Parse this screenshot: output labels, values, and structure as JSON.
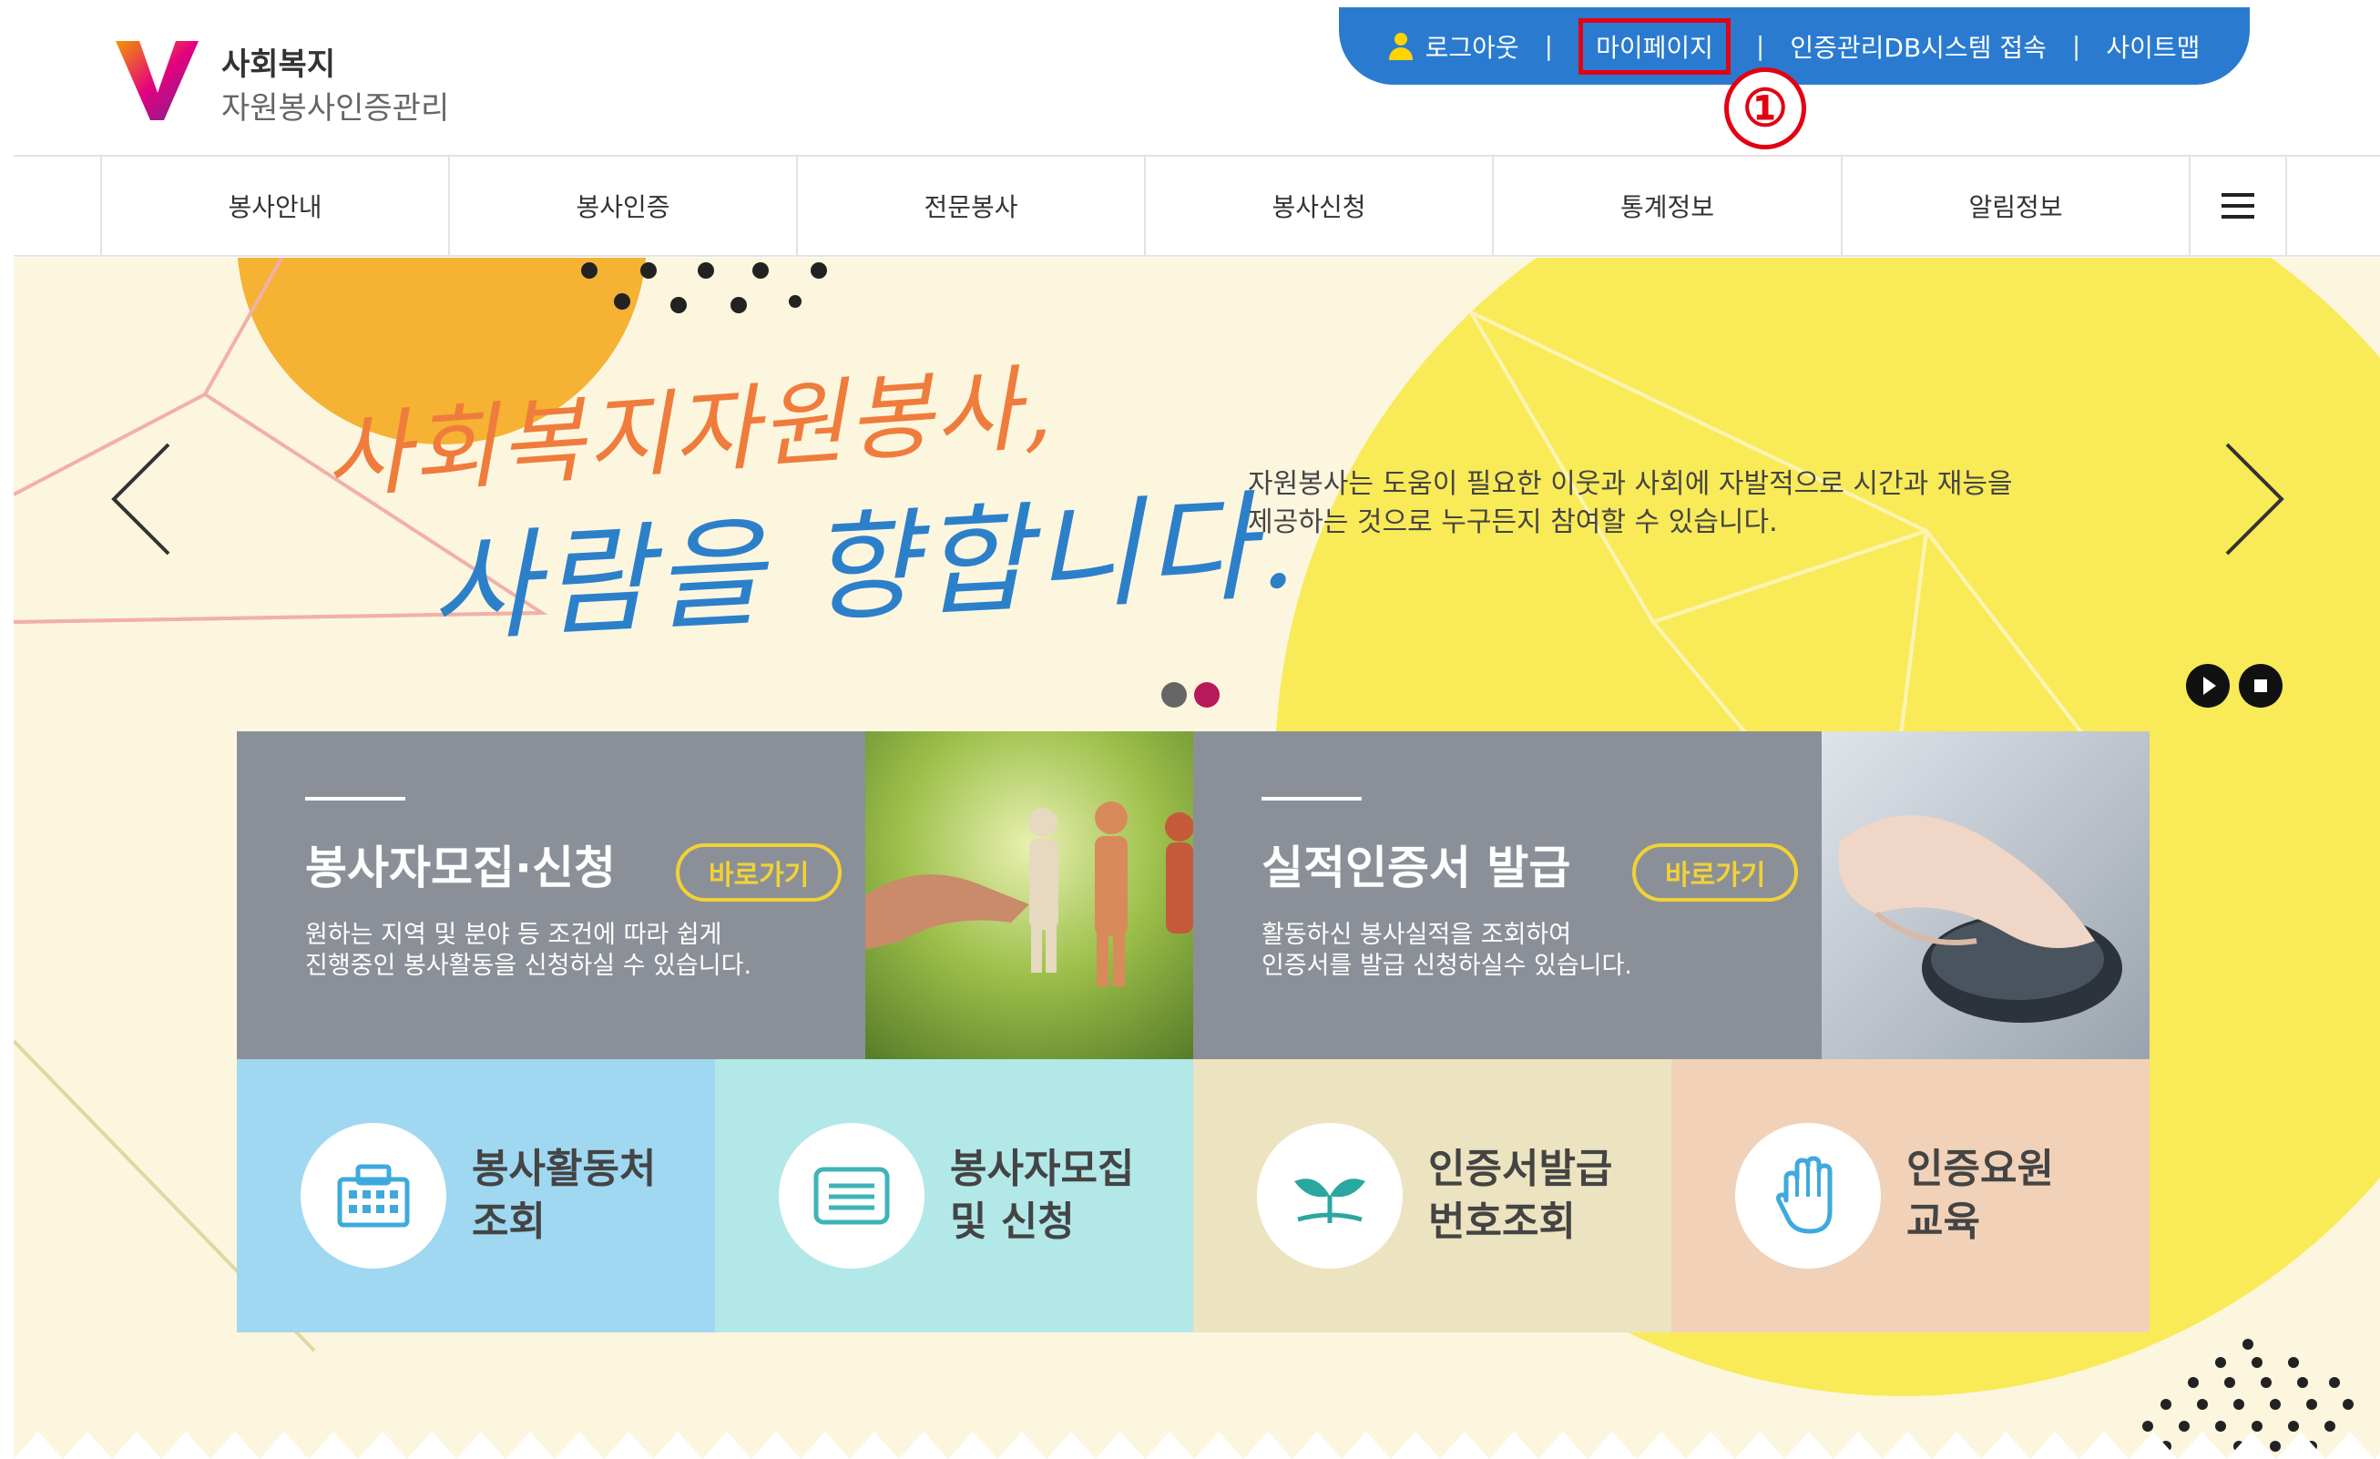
{
  "header": {
    "logo_title": "사회복지",
    "logo_subtitle": "자원봉사인증관리",
    "logo_letter": "V",
    "topbar": {
      "logout": "로그아웃",
      "mypage": "마이페이지",
      "db_access": "인증관리DB시스템 접속",
      "sitemap": "사이트맵",
      "separator": "|"
    },
    "annotation_marker": "①"
  },
  "nav": {
    "items": [
      "봉사안내",
      "봉사인증",
      "전문봉사",
      "봉사신청",
      "통계정보",
      "알림정보"
    ],
    "menu_icon": "hamburger-icon"
  },
  "hero": {
    "headline_line1": "사회복지자원봉사,",
    "headline_line2": "사람을 향합니다.",
    "description_line1": "자원봉사는 도움이 필요한 이웃과 사회에 자발적으로 시간과 재능을",
    "description_line2": "제공하는 것으로 누구든지 참여할 수 있습니다.",
    "slide_count": 2,
    "active_slide": 2
  },
  "cards": [
    {
      "title": "봉사자모집·신청",
      "button": "바로가기",
      "desc_line1": "원하는 지역 및 분야 등 조건에 따라 쉽게",
      "desc_line2": "진행중인 봉사활동을 신청하실 수 있습니다."
    },
    {
      "title": "실적인증서 발급",
      "button": "바로가기",
      "desc_line1": "활동하신 봉사실적을 조회하여",
      "desc_line2": "인증서를 발급 신청하실수 있습니다."
    }
  ],
  "quick_links": [
    {
      "line1": "봉사활동처",
      "line2": "조회",
      "icon": "building-icon"
    },
    {
      "line1": "봉사자모집",
      "line2": "및 신청",
      "icon": "document-icon"
    },
    {
      "line1": "인증서발급",
      "line2": "번호조회",
      "icon": "sprout-icon"
    },
    {
      "line1": "인증요원",
      "line2": "교육",
      "icon": "hand-icon"
    }
  ],
  "colors": {
    "topbar": "#2a7bd0",
    "highlight": "#e30012",
    "hero_bg": "#fcf6df",
    "card_gray": "#8b9098",
    "accent_yellow": "#f2d235",
    "quick_blue": "#9fd8f0",
    "quick_mint": "#b2e8e8",
    "quick_beige": "#ece4c0",
    "quick_peach": "#f1d2b8"
  }
}
